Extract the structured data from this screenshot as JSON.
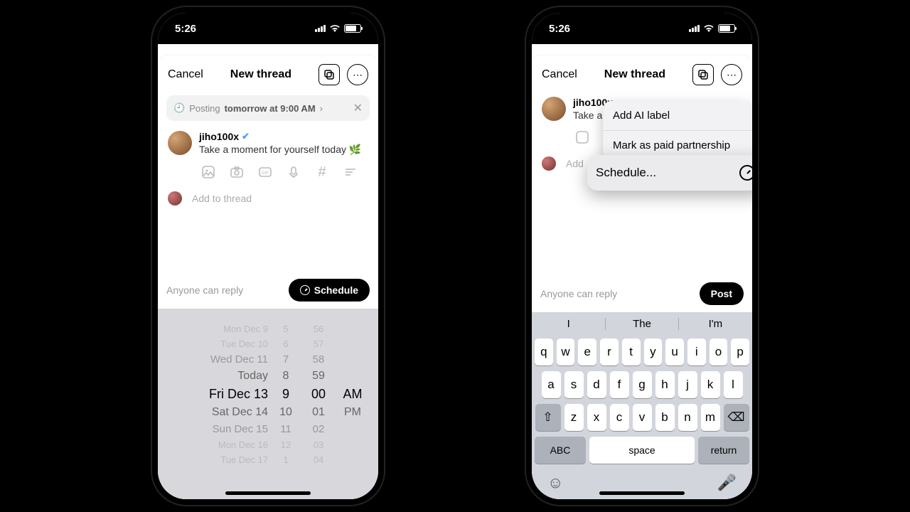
{
  "left": {
    "status_time": "5:26",
    "cancel": "Cancel",
    "title": "New thread",
    "posting_prefix": "Posting",
    "posting_time": "tomorrow at 9:00 AM",
    "username": "jiho100x",
    "post_text": "Take a moment for yourself today",
    "add_thread": "Add to thread",
    "reply_scope": "Anyone can reply",
    "schedule_button": "Schedule",
    "picker_rows": [
      {
        "date": "Mon Dec 9",
        "h": "5",
        "m": "56",
        "ap": ""
      },
      {
        "date": "Tue Dec 10",
        "h": "6",
        "m": "57",
        "ap": ""
      },
      {
        "date": "Wed Dec 11",
        "h": "7",
        "m": "58",
        "ap": ""
      },
      {
        "date": "Today",
        "h": "8",
        "m": "59",
        "ap": ""
      },
      {
        "date": "Fri Dec 13",
        "h": "9",
        "m": "00",
        "ap": "AM"
      },
      {
        "date": "Sat Dec 14",
        "h": "10",
        "m": "01",
        "ap": "PM"
      },
      {
        "date": "Sun Dec 15",
        "h": "11",
        "m": "02",
        "ap": ""
      },
      {
        "date": "Mon Dec 16",
        "h": "12",
        "m": "03",
        "ap": ""
      },
      {
        "date": "Tue Dec 17",
        "h": "1",
        "m": "04",
        "ap": ""
      }
    ]
  },
  "right": {
    "status_time": "5:26",
    "cancel": "Cancel",
    "title": "New thread",
    "username": "jiho100x",
    "post_text_partial": "Take a m",
    "add_thread": "Add",
    "reply_scope": "Anyone can reply",
    "post_button": "Post",
    "menu_item_1": "Add AI label",
    "menu_item_2": "Mark as paid partnership",
    "schedule_label": "Schedule...",
    "suggestions": [
      "I",
      "The",
      "I'm"
    ],
    "row1": [
      "q",
      "w",
      "e",
      "r",
      "t",
      "y",
      "u",
      "i",
      "o",
      "p"
    ],
    "row2": [
      "a",
      "s",
      "d",
      "f",
      "g",
      "h",
      "j",
      "k",
      "l"
    ],
    "row3": [
      "z",
      "x",
      "c",
      "v",
      "b",
      "n",
      "m"
    ],
    "abc": "ABC",
    "space": "space",
    "return": "return"
  }
}
